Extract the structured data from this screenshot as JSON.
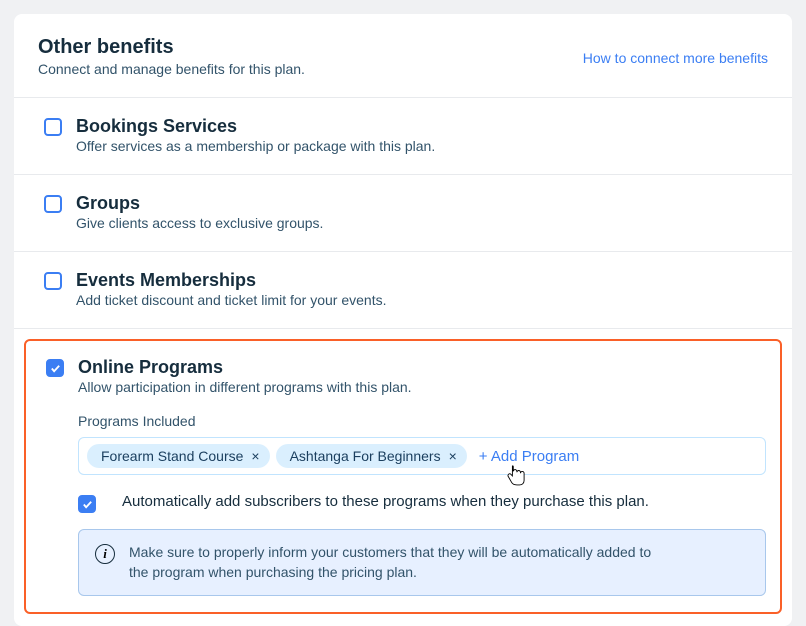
{
  "header": {
    "title": "Other benefits",
    "subtitle": "Connect and manage benefits for this plan.",
    "link": "How to connect more benefits"
  },
  "benefits": {
    "bookings": {
      "title": "Bookings Services",
      "subtitle": "Offer services as a membership or package with this plan."
    },
    "groups": {
      "title": "Groups",
      "subtitle": "Give clients access to exclusive groups."
    },
    "events": {
      "title": "Events Memberships",
      "subtitle": "Add ticket discount and ticket limit for your events."
    },
    "programs": {
      "title": "Online Programs",
      "subtitle": "Allow participation in different programs with this plan.",
      "includedLabel": "Programs Included",
      "tags": [
        "Forearm Stand Course",
        "Ashtanga For Beginners"
      ],
      "addLabel": "+ Add Program",
      "autoAddLabel": "Automatically add subscribers to these programs when they purchase this plan.",
      "infoText": "Make sure to properly inform your customers that they will be automatically added to the program when purchasing the pricing plan."
    }
  }
}
